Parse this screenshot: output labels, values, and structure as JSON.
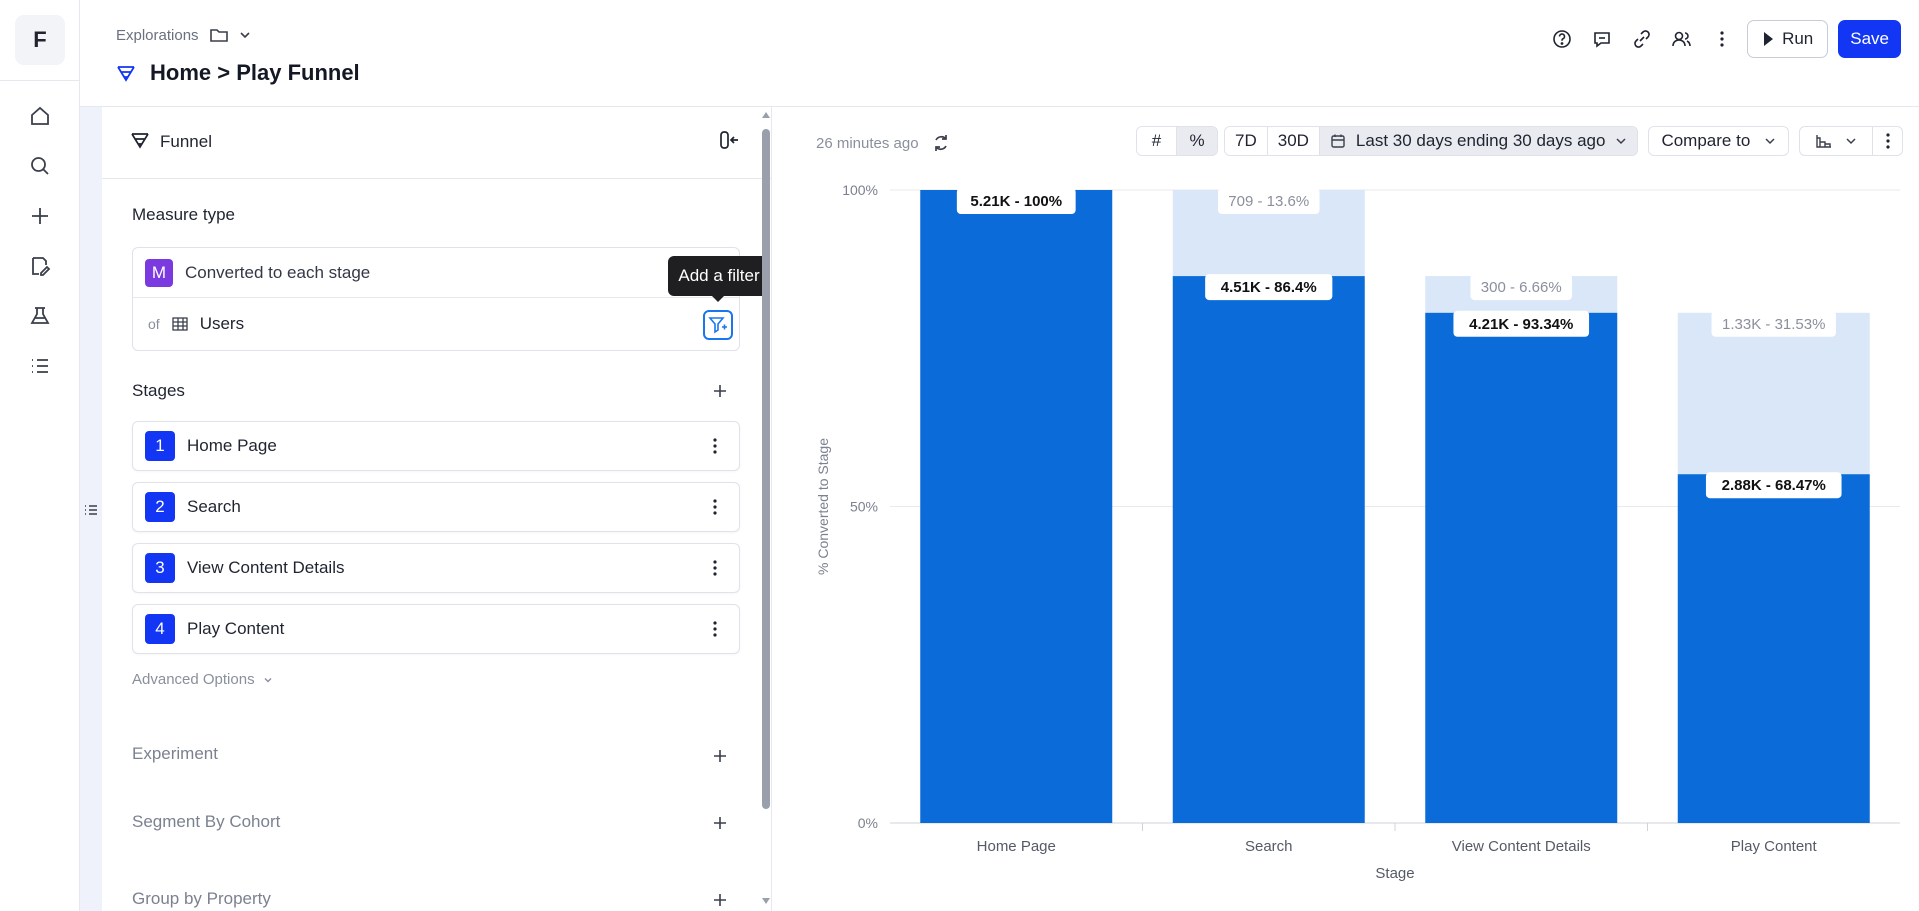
{
  "app": {
    "logo_letter": "F"
  },
  "nav": {
    "items": [
      {
        "icon": "home-icon"
      },
      {
        "icon": "search-icon"
      },
      {
        "icon": "plus-icon"
      },
      {
        "icon": "edit-icon"
      },
      {
        "icon": "flask-icon"
      },
      {
        "icon": "list-icon"
      }
    ]
  },
  "header": {
    "breadcrumb": "Explorations",
    "title": "Home > Play Funnel",
    "run_label": "Run",
    "save_label": "Save"
  },
  "panel": {
    "header_label": "Funnel",
    "measure_type_title": "Measure type",
    "measure_badge": "M",
    "measure_value": "Converted to each stage",
    "of_label": "of",
    "entity": "Users",
    "tooltip": "Add a filter",
    "stages_title": "Stages",
    "stages": [
      {
        "num": "1",
        "name": "Home Page"
      },
      {
        "num": "2",
        "name": "Search"
      },
      {
        "num": "3",
        "name": "View Content Details"
      },
      {
        "num": "4",
        "name": "Play Content"
      }
    ],
    "advanced_options": "Advanced Options",
    "sections": [
      "Experiment",
      "Segment By Cohort",
      "Group by Property"
    ]
  },
  "toolbar": {
    "updated": "26 minutes ago",
    "count_icon": "#",
    "percent_icon": "%",
    "btn_7d": "7D",
    "btn_30d": "30D",
    "date_range": "Last 30 days ending 30 days ago",
    "compare": "Compare to"
  },
  "colors": {
    "accent": "#1336f5",
    "bar": "#0b6bd8",
    "bar_dropoff": "#dae7f8",
    "badge_purple": "#7b3ae0"
  },
  "chart_data": {
    "type": "bar",
    "stacked": true,
    "categories": [
      "Home Page",
      "Search",
      "View Content Details",
      "Play Content"
    ],
    "series": [
      {
        "values": [
          100,
          86.4,
          80.6,
          55.1
        ],
        "labels": [
          "5.21K - 100%",
          "4.51K - 86.4%",
          "4.21K - 93.34%",
          "2.88K - 68.47%"
        ]
      },
      {
        "values": [
          0,
          13.6,
          5.8,
          25.5
        ],
        "labels": [
          "",
          "709 - 13.6%",
          "300 - 6.66%",
          "1.33K - 31.53%"
        ]
      }
    ],
    "xlabel": "Stage",
    "ylabel": "% Converted to Stage",
    "yticks": [
      "100%",
      "50%",
      "0%"
    ],
    "ylim": [
      0,
      100
    ],
    "grid": true
  }
}
